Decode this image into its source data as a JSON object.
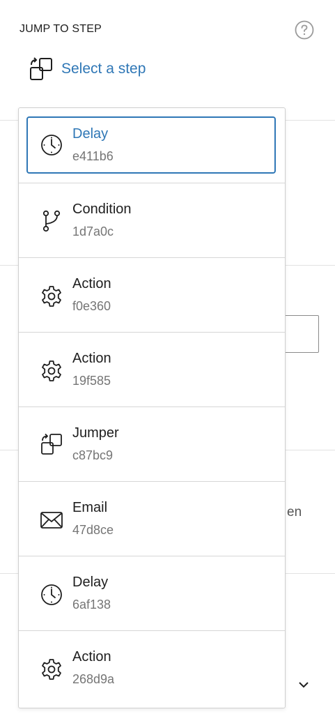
{
  "header": {
    "title": "JUMP TO STEP",
    "help_icon": "help-circle-icon",
    "select_label": "Select a step",
    "select_icon": "jumper-icon"
  },
  "background": {
    "partial_text": "en"
  },
  "colors": {
    "accent": "#2f77b6",
    "text": "#1e1e1e",
    "muted": "#757575",
    "border": "#d6d6d6"
  },
  "dropdown": {
    "items": [
      {
        "name": "Delay",
        "id": "e411b6",
        "icon": "clock-icon",
        "selected": true
      },
      {
        "name": "Condition",
        "id": "1d7a0c",
        "icon": "branch-icon",
        "selected": false
      },
      {
        "name": "Action",
        "id": "f0e360",
        "icon": "gear-icon",
        "selected": false
      },
      {
        "name": "Action",
        "id": "19f585",
        "icon": "gear-icon",
        "selected": false
      },
      {
        "name": "Jumper",
        "id": "c87bc9",
        "icon": "jumper-icon",
        "selected": false
      },
      {
        "name": "Email",
        "id": "47d8ce",
        "icon": "envelope-icon",
        "selected": false
      },
      {
        "name": "Delay",
        "id": "6af138",
        "icon": "clock-icon",
        "selected": false
      },
      {
        "name": "Action",
        "id": "268d9a",
        "icon": "gear-icon",
        "selected": false
      }
    ]
  }
}
